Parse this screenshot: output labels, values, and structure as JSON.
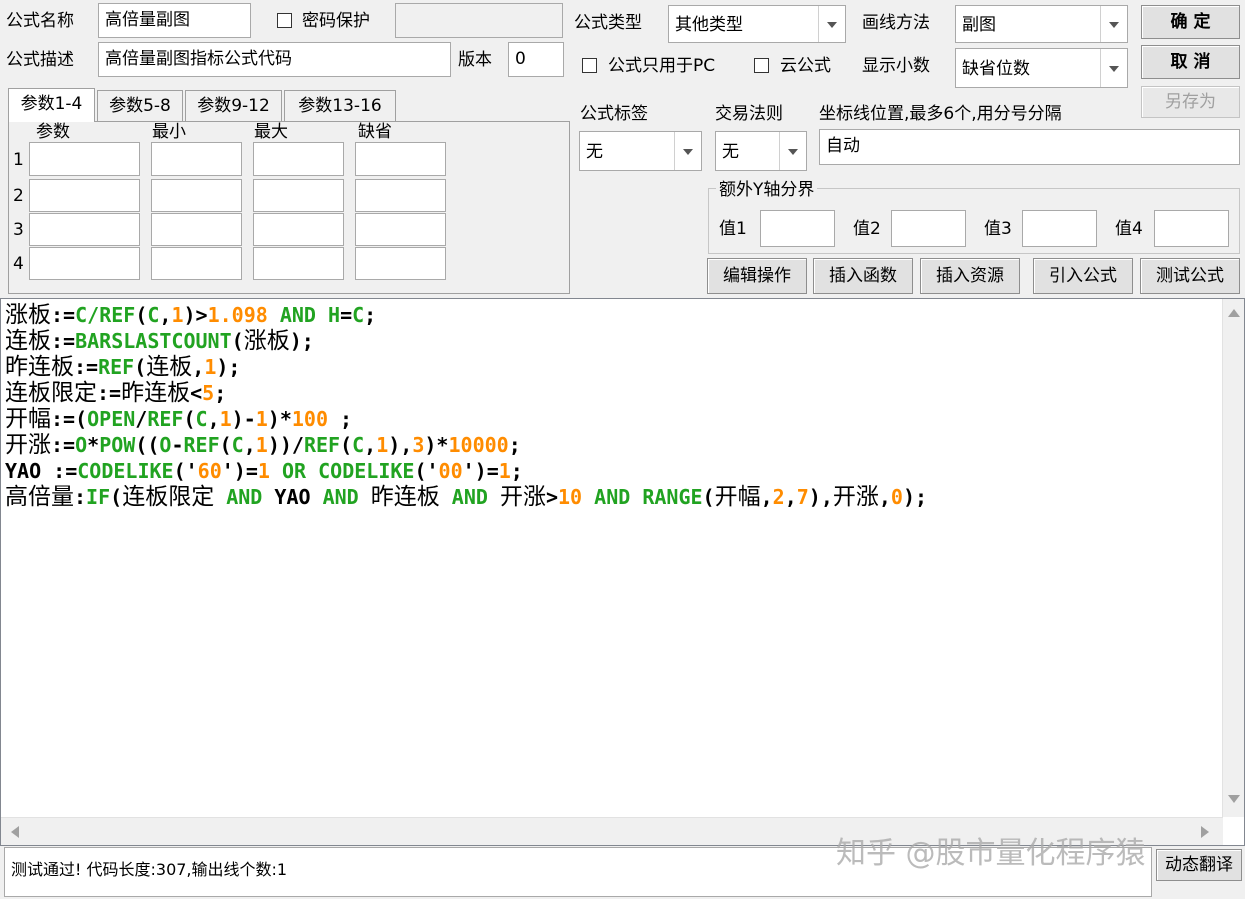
{
  "header": {
    "formula_name_label": "公式名称",
    "formula_name_value": "高倍量副图",
    "password_label": "密码保护",
    "password_checked": false,
    "formula_desc_label": "公式描述",
    "formula_desc_value": "高倍量副图指标公式代码",
    "version_label": "版本",
    "version_value": "0",
    "formula_type_label": "公式类型",
    "formula_type_value": "其他类型",
    "draw_method_label": "画线方法",
    "draw_method_value": "副图",
    "pc_only_label": "公式只用于PC",
    "pc_only_checked": false,
    "cloud_label": "云公式",
    "cloud_checked": false,
    "decimals_label": "显示小数",
    "decimals_value": "缺省位数"
  },
  "buttons": {
    "ok": "确  定",
    "cancel": "取  消",
    "save_as": "另存为",
    "edit_ops": "编辑操作",
    "insert_func": "插入函数",
    "insert_res": "插入资源",
    "import_formula": "引入公式",
    "test_formula": "测试公式",
    "dynamic_translate": "动态翻译"
  },
  "params": {
    "tabs": [
      "参数1-4",
      "参数5-8",
      "参数9-12",
      "参数13-16"
    ],
    "active_tab": 0,
    "columns": [
      "参数",
      "最小",
      "最大",
      "缺省"
    ],
    "rows": [
      "1",
      "2",
      "3",
      "4"
    ]
  },
  "options": {
    "tag_label": "公式标签",
    "tag_value": "无",
    "trade_rule_label": "交易法则",
    "trade_rule_value": "无",
    "axis_label": "坐标线位置,最多6个,用分号分隔",
    "axis_value": "自动",
    "extra_y_label": "额外Y轴分界",
    "value_labels": [
      "值1",
      "值2",
      "值3",
      "值4"
    ]
  },
  "code_lines": [
    [
      {
        "t": "涨板",
        "c": "cn"
      },
      {
        "t": ":=",
        "c": "pl"
      },
      {
        "t": "C/",
        "c": "kw"
      },
      {
        "t": "REF",
        "c": "kw"
      },
      {
        "t": "(",
        "c": "pl"
      },
      {
        "t": "C",
        "c": "kw"
      },
      {
        "t": ",",
        "c": "pl"
      },
      {
        "t": "1",
        "c": "num"
      },
      {
        "t": ")>",
        "c": "pl"
      },
      {
        "t": "1.098",
        "c": "num"
      },
      {
        "t": " AND ",
        "c": "kw"
      },
      {
        "t": "H",
        "c": "kw"
      },
      {
        "t": "=",
        "c": "pl"
      },
      {
        "t": "C",
        "c": "kw"
      },
      {
        "t": ";",
        "c": "pl"
      }
    ],
    [
      {
        "t": "连板",
        "c": "cn"
      },
      {
        "t": ":=",
        "c": "pl"
      },
      {
        "t": "BARSLASTCOUNT",
        "c": "kw"
      },
      {
        "t": "(",
        "c": "pl"
      },
      {
        "t": "涨板",
        "c": "cn"
      },
      {
        "t": ");",
        "c": "pl"
      }
    ],
    [
      {
        "t": "昨连板",
        "c": "cn"
      },
      {
        "t": ":=",
        "c": "pl"
      },
      {
        "t": "REF",
        "c": "kw"
      },
      {
        "t": "(",
        "c": "pl"
      },
      {
        "t": "连板",
        "c": "cn"
      },
      {
        "t": ",",
        "c": "pl"
      },
      {
        "t": "1",
        "c": "num"
      },
      {
        "t": ");",
        "c": "pl"
      }
    ],
    [
      {
        "t": "连板限定",
        "c": "cn"
      },
      {
        "t": ":=",
        "c": "pl"
      },
      {
        "t": "昨连板",
        "c": "cn"
      },
      {
        "t": "<",
        "c": "pl"
      },
      {
        "t": "5",
        "c": "num"
      },
      {
        "t": ";",
        "c": "pl"
      }
    ],
    [
      {
        "t": "开幅",
        "c": "cn"
      },
      {
        "t": ":=(",
        "c": "pl"
      },
      {
        "t": "OPEN",
        "c": "kw"
      },
      {
        "t": "/",
        "c": "pl"
      },
      {
        "t": "REF",
        "c": "kw"
      },
      {
        "t": "(",
        "c": "pl"
      },
      {
        "t": "C",
        "c": "kw"
      },
      {
        "t": ",",
        "c": "pl"
      },
      {
        "t": "1",
        "c": "num"
      },
      {
        "t": ")-",
        "c": "pl"
      },
      {
        "t": "1",
        "c": "num"
      },
      {
        "t": ")*",
        "c": "pl"
      },
      {
        "t": "100",
        "c": "num"
      },
      {
        "t": " ;",
        "c": "pl"
      }
    ],
    [
      {
        "t": "开涨",
        "c": "cn"
      },
      {
        "t": ":=",
        "c": "pl"
      },
      {
        "t": "O",
        "c": "kw"
      },
      {
        "t": "*",
        "c": "pl"
      },
      {
        "t": "POW",
        "c": "kw"
      },
      {
        "t": "((",
        "c": "pl"
      },
      {
        "t": "O",
        "c": "kw"
      },
      {
        "t": "-",
        "c": "pl"
      },
      {
        "t": "REF",
        "c": "kw"
      },
      {
        "t": "(",
        "c": "pl"
      },
      {
        "t": "C",
        "c": "kw"
      },
      {
        "t": ",",
        "c": "pl"
      },
      {
        "t": "1",
        "c": "num"
      },
      {
        "t": "))/",
        "c": "pl"
      },
      {
        "t": "REF",
        "c": "kw"
      },
      {
        "t": "(",
        "c": "pl"
      },
      {
        "t": "C",
        "c": "kw"
      },
      {
        "t": ",",
        "c": "pl"
      },
      {
        "t": "1",
        "c": "num"
      },
      {
        "t": "),",
        "c": "pl"
      },
      {
        "t": "3",
        "c": "num"
      },
      {
        "t": ")*",
        "c": "pl"
      },
      {
        "t": "10000",
        "c": "num"
      },
      {
        "t": ";",
        "c": "pl"
      }
    ],
    [
      {
        "t": "YAO :=",
        "c": "pl"
      },
      {
        "t": "CODELIKE",
        "c": "kw"
      },
      {
        "t": "('",
        "c": "pl"
      },
      {
        "t": "60",
        "c": "num"
      },
      {
        "t": "')=",
        "c": "pl"
      },
      {
        "t": "1",
        "c": "num"
      },
      {
        "t": " OR ",
        "c": "kw"
      },
      {
        "t": "CODELIKE",
        "c": "kw"
      },
      {
        "t": "('",
        "c": "pl"
      },
      {
        "t": "00",
        "c": "num"
      },
      {
        "t": "')=",
        "c": "pl"
      },
      {
        "t": "1",
        "c": "num"
      },
      {
        "t": ";",
        "c": "pl"
      }
    ],
    [
      {
        "t": "高倍量",
        "c": "cn"
      },
      {
        "t": ":",
        "c": "pl"
      },
      {
        "t": "IF",
        "c": "kw"
      },
      {
        "t": "(",
        "c": "pl"
      },
      {
        "t": "连板限定",
        "c": "cn"
      },
      {
        "t": " AND ",
        "c": "kw"
      },
      {
        "t": "YAO",
        "c": "pl"
      },
      {
        "t": " AND ",
        "c": "kw"
      },
      {
        "t": "昨连板",
        "c": "cn"
      },
      {
        "t": " AND ",
        "c": "kw"
      },
      {
        "t": "开涨",
        "c": "cn"
      },
      {
        "t": ">",
        "c": "pl"
      },
      {
        "t": "10",
        "c": "num"
      },
      {
        "t": " AND ",
        "c": "kw"
      },
      {
        "t": "RANGE",
        "c": "kw"
      },
      {
        "t": "(",
        "c": "pl"
      },
      {
        "t": "开幅",
        "c": "cn"
      },
      {
        "t": ",",
        "c": "pl"
      },
      {
        "t": "2",
        "c": "num"
      },
      {
        "t": ",",
        "c": "pl"
      },
      {
        "t": "7",
        "c": "num"
      },
      {
        "t": "),",
        "c": "pl"
      },
      {
        "t": "开涨",
        "c": "cn"
      },
      {
        "t": ",",
        "c": "pl"
      },
      {
        "t": "0",
        "c": "num"
      },
      {
        "t": ");",
        "c": "pl"
      }
    ]
  ],
  "status_text": "测试通过! 代码长度:307,输出线个数:1",
  "watermark": "知乎 @股市量化程序猿",
  "colors": {
    "keyword": "#21a321",
    "number": "#ff8c00",
    "plain": "#000000",
    "background": "#f0f0f0"
  }
}
